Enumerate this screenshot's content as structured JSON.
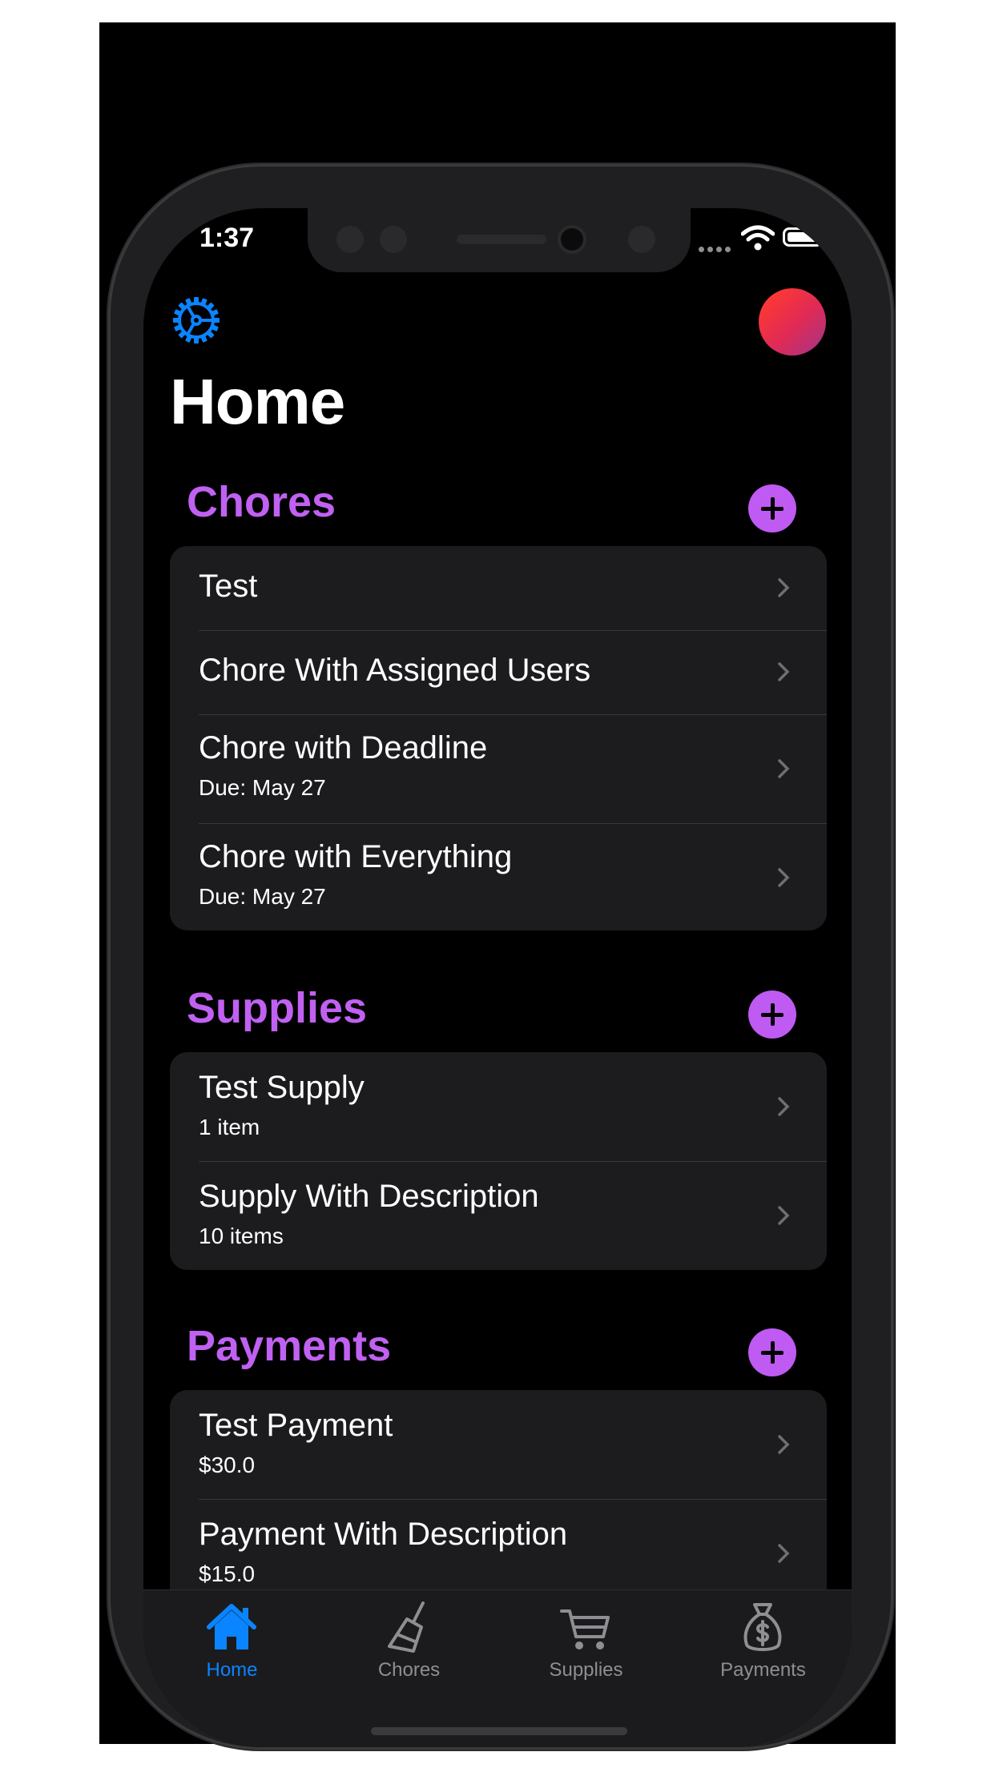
{
  "status_bar": {
    "time": "1:37"
  },
  "header": {
    "title": "Home"
  },
  "sections": {
    "chores": {
      "title": "Chores",
      "items": [
        {
          "title": "Test",
          "subtitle": ""
        },
        {
          "title": "Chore With Assigned Users",
          "subtitle": ""
        },
        {
          "title": "Chore with Deadline",
          "subtitle": "Due: May 27"
        },
        {
          "title": "Chore with Everything",
          "subtitle": "Due: May 27"
        }
      ]
    },
    "supplies": {
      "title": "Supplies",
      "items": [
        {
          "title": "Test Supply",
          "subtitle": "1 item"
        },
        {
          "title": "Supply With Description",
          "subtitle": "10 items"
        }
      ]
    },
    "payments": {
      "title": "Payments",
      "items": [
        {
          "title": "Test Payment",
          "subtitle": "$30.0"
        },
        {
          "title": "Payment With Description",
          "subtitle": "$15.0"
        }
      ]
    }
  },
  "tabbar": {
    "tabs": [
      {
        "label": "Home",
        "icon": "house-icon",
        "selected": true
      },
      {
        "label": "Chores",
        "icon": "broom-icon",
        "selected": false
      },
      {
        "label": "Supplies",
        "icon": "cart-icon",
        "selected": false
      },
      {
        "label": "Payments",
        "icon": "money-bag-icon",
        "selected": false
      }
    ]
  },
  "colors": {
    "accent": "#bf5af2",
    "tab_selected": "#0a84ff",
    "tab_unselected": "#8e8e93",
    "card_background": "#1c1c1e",
    "background": "#000000"
  }
}
